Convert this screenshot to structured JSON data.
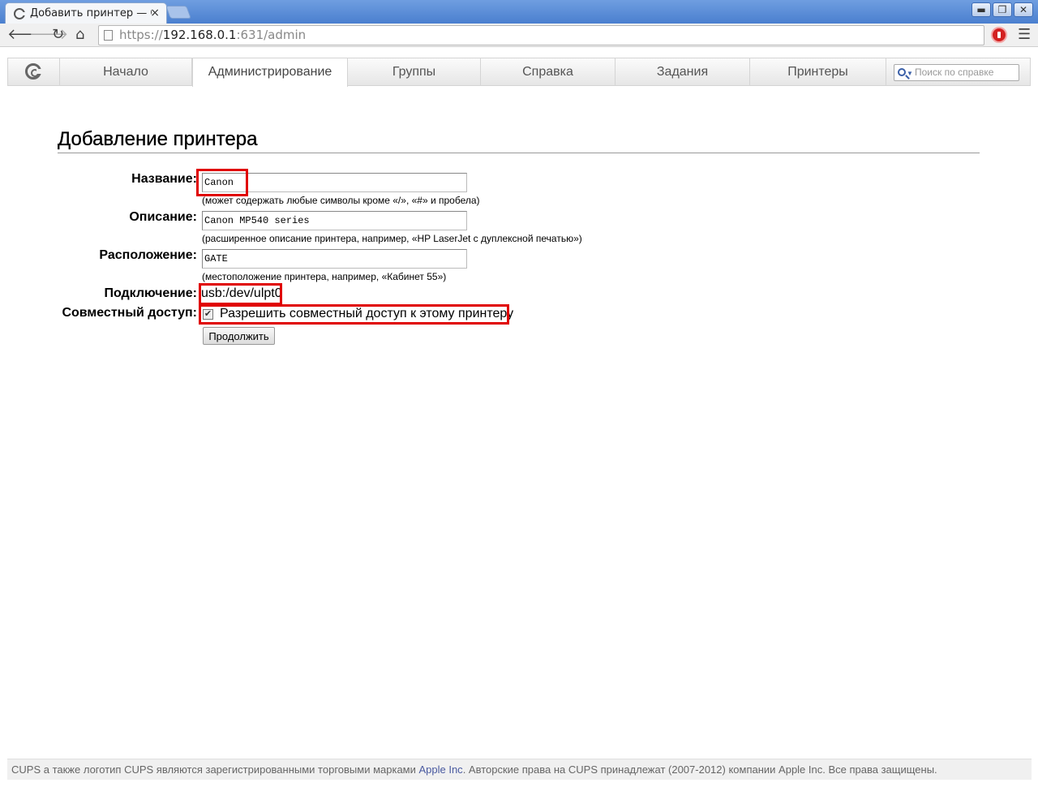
{
  "browser": {
    "tab_title": "Добавить принтер — CUPS",
    "tab_close": "×",
    "url_scheme": "https://",
    "url_host": "192.168.0.1",
    "url_path": ":631/admin",
    "window_min": "▬",
    "window_max": "❐",
    "window_close": "✕"
  },
  "nav": {
    "items": [
      {
        "label": "Начало"
      },
      {
        "label": "Администрирование",
        "active": true
      },
      {
        "label": "Группы"
      },
      {
        "label": "Справка"
      },
      {
        "label": "Задания"
      },
      {
        "label": "Принтеры"
      }
    ],
    "search_placeholder": "Поиск по справке"
  },
  "page": {
    "title": "Добавление принтера"
  },
  "form": {
    "name_label": "Название:",
    "name_value": "Canon",
    "name_hint": "(может содержать любые символы кроме «/», «#» и пробела)",
    "description_label": "Описание:",
    "description_value": "Canon MP540 series",
    "description_hint": "(расширенное описание принтера, например, «HP LaserJet с дуплексной печатью»)",
    "location_label": "Расположение:",
    "location_value": "GATE",
    "location_hint": "(местоположение принтера, например, «Кабинет 55»)",
    "connection_label": "Подключение:",
    "connection_value": "usb:/dev/ulpt0",
    "sharing_label": "Совместный доступ:",
    "sharing_checked": true,
    "sharing_option": "Разрешить совместный доступ к этому принтеру",
    "continue_label": "Продолжить"
  },
  "footer": {
    "text_before": "CUPS а также логотип CUPS являются зарегистрированными торговыми марками ",
    "link": "Apple Inc",
    "text_after": ". Авторские права на CUPS принадлежат (2007-2012) компании Apple Inc. Все права защищены."
  },
  "colors": {
    "highlight": "#e00000",
    "link": "#4a5aa0"
  }
}
